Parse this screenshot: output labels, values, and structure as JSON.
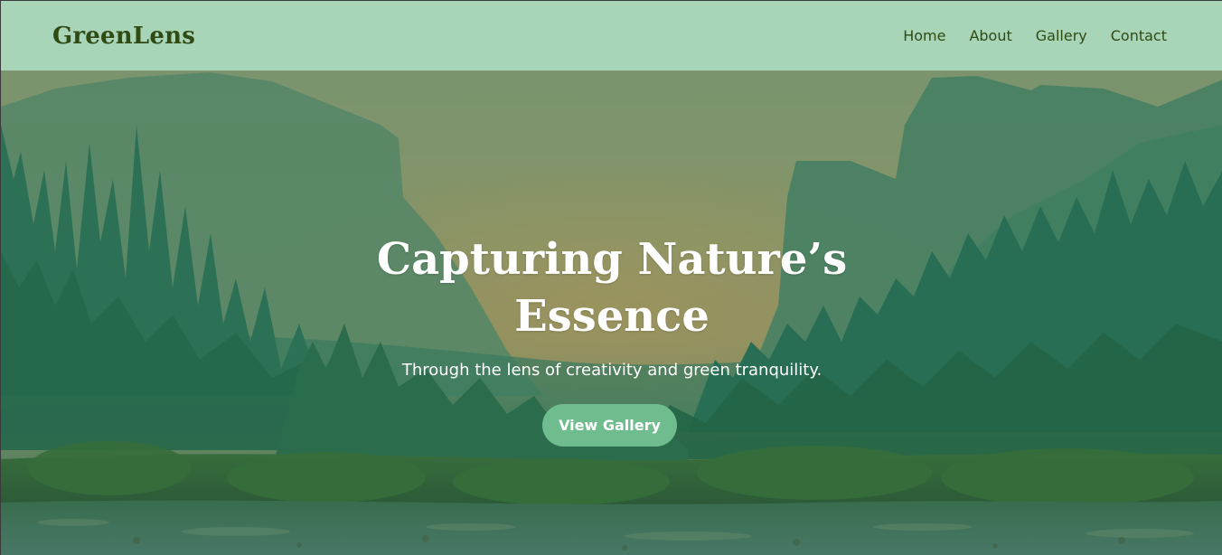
{
  "site": {
    "logo": "GreenLens"
  },
  "nav": {
    "items": [
      "Home",
      "About",
      "Gallery",
      "Contact"
    ]
  },
  "hero": {
    "title": "Capturing Nature’s Essence",
    "subtitle": "Through the lens of creativity and green tranquility.",
    "cta_label": "View Gallery"
  },
  "colors": {
    "header_bg": "#a8d5b8",
    "logo_text": "#2f4a12",
    "nav_text": "#2f4a12",
    "button_bg": "#6fbc8e",
    "overlay_green": "#1f7a5c"
  }
}
